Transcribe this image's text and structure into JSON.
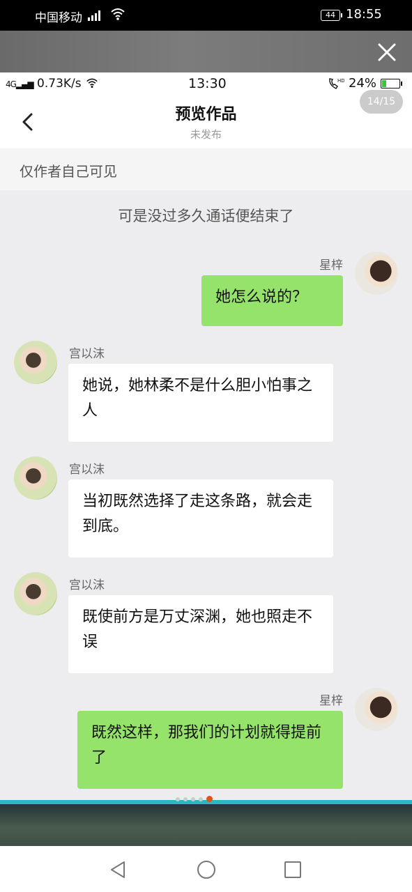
{
  "outer_status": {
    "carrier": "中国移动",
    "network": "4G",
    "battery": "44",
    "time": "18:55"
  },
  "inner_status": {
    "speed": "0.73K/s",
    "time": "13:30",
    "battery": "24%"
  },
  "header": {
    "title": "预览作品",
    "subtitle": "未发布",
    "pager": "14/15"
  },
  "visibility_note": "仅作者自己可见",
  "narration": "可是没过多久通话便结束了",
  "messages": [
    {
      "side": "right",
      "name": "星梓",
      "text": "她怎么说的？"
    },
    {
      "side": "left",
      "name": "宫以沫",
      "text": "她说，她林柔不是什么胆小怕事之人"
    },
    {
      "side": "left",
      "name": "宫以沫",
      "text": "当初既然选择了走这条路，就会走到底。"
    },
    {
      "side": "left",
      "name": "宫以沫",
      "text": "既使前方是万丈深渊，她也照走不误"
    },
    {
      "side": "right",
      "name": "星梓",
      "text": "既然这样，那我们的计划就得提前了"
    }
  ],
  "colors": {
    "outgoing_bubble": "#95e36a",
    "incoming_bubble": "#ffffff",
    "page_dot_active": "#e8501c"
  },
  "page_dots": {
    "count": 5,
    "active_index": 4
  }
}
